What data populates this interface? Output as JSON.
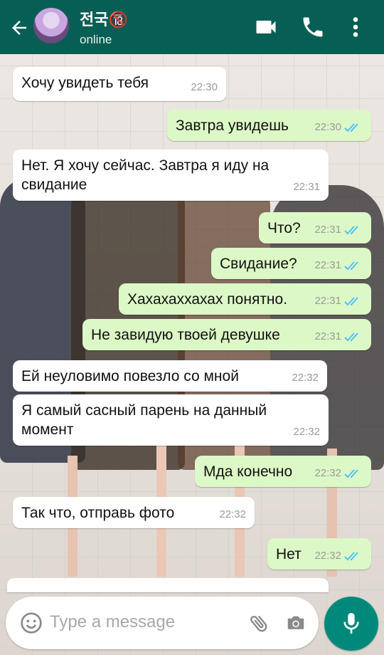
{
  "header": {
    "contact_name": "전국🔞",
    "status": "online",
    "icons": [
      "back-arrow-icon",
      "video-call-icon",
      "phone-icon",
      "more-vert-icon"
    ]
  },
  "messages": [
    {
      "direction": "in",
      "text": "Хочу увидеть тебя",
      "time": "22:30"
    },
    {
      "direction": "out",
      "text": "Завтра увидешь",
      "time": "22:30",
      "read": true
    },
    {
      "direction": "in",
      "text": "Нет. Я хочу сейчас. Завтра я иду на свидание",
      "time": "22:31"
    },
    {
      "direction": "out",
      "text": "Что?",
      "time": "22:31",
      "read": true
    },
    {
      "direction": "out",
      "text": "Свидание?",
      "time": "22:31",
      "read": true
    },
    {
      "direction": "out",
      "text": "Хахахаххахах понятно.",
      "time": "22:31",
      "read": true
    },
    {
      "direction": "out",
      "text": "Не завидую твоей девушке",
      "time": "22:31",
      "read": true
    },
    {
      "direction": "in",
      "text": "Ей неуловимо повезло со мной",
      "time": "22:32"
    },
    {
      "direction": "in",
      "text": "Я самый сасный парень на данный момент",
      "time": "22:32"
    },
    {
      "direction": "out",
      "text": "Мда конечно",
      "time": "22:32",
      "read": true
    },
    {
      "direction": "in",
      "text": "Так что, отправь фото",
      "time": "22:32"
    },
    {
      "direction": "out",
      "text": "Нет",
      "time": "22:32",
      "read": true
    }
  ],
  "composer": {
    "placeholder": "Type a message",
    "icons": [
      "emoji-icon",
      "attach-icon",
      "camera-icon",
      "mic-icon"
    ]
  },
  "colors": {
    "header": "#075e54",
    "incoming_bubble": "#ffffff",
    "outgoing_bubble": "#dcf8c6",
    "read_ticks": "#4fc3f7",
    "mic_button": "#00897b"
  }
}
